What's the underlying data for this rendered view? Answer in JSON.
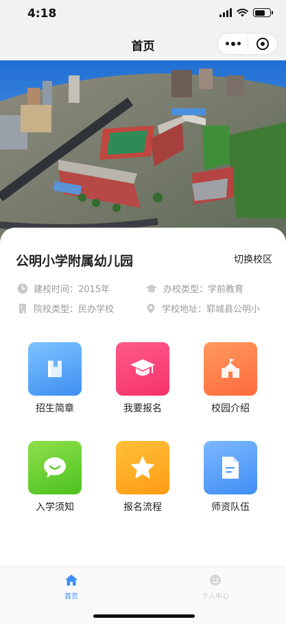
{
  "status_bar": {
    "time": "4:18",
    "battery_level": 0.7
  },
  "nav": {
    "title": "首页",
    "icons": [
      "more-dots-icon",
      "close-circle-icon"
    ]
  },
  "banner": {
    "description_icon": "campus-aerial-photo"
  },
  "school": {
    "name": "公明小学附属幼儿园",
    "switch_label": "切换校区",
    "info": {
      "founded": "建校时间：2015年",
      "type": "办校类型：学前教育",
      "category": "院校类型：民办学校",
      "address": "学校地址：郓城县公明小"
    }
  },
  "menu": [
    {
      "label": "招生简章",
      "icon": "book-icon",
      "colors": [
        "#7ec3ff",
        "#3d8ff2"
      ]
    },
    {
      "label": "我要报名",
      "icon": "graduation-cap-icon",
      "colors": [
        "#ff5a8a",
        "#f5336b"
      ]
    },
    {
      "label": "校园介绍",
      "icon": "school-building-icon",
      "colors": [
        "#ff9a5c",
        "#ff6a3d"
      ]
    },
    {
      "label": "入学须知",
      "icon": "chat-bubble-icon",
      "colors": [
        "#8ee04a",
        "#4cc21f"
      ]
    },
    {
      "label": "报名流程",
      "icon": "star-icon",
      "colors": [
        "#ffc03a",
        "#ff9a14"
      ]
    },
    {
      "label": "师资队伍",
      "icon": "document-icon",
      "colors": [
        "#7cb8ff",
        "#3f8ef5"
      ]
    }
  ],
  "tabs": [
    {
      "label": "首页",
      "icon": "home-icon",
      "active": true,
      "color": "#3a8ef5"
    },
    {
      "label": "个人中心",
      "icon": "user-smile-icon",
      "active": false,
      "color": "#c8c8c8"
    }
  ]
}
